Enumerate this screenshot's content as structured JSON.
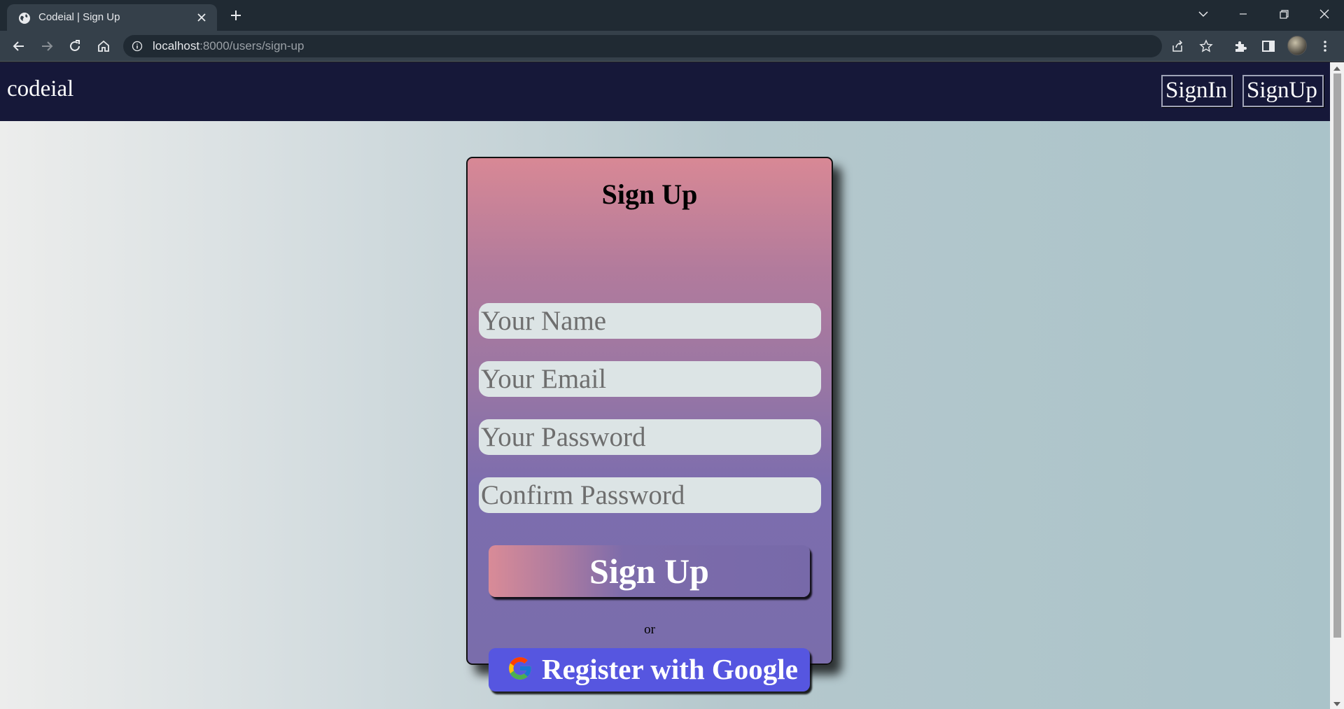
{
  "browser": {
    "tab_title": "Codeial | Sign Up",
    "url_host": "localhost",
    "url_rest": ":8000/users/sign-up"
  },
  "navbar": {
    "brand": "codeial",
    "signin_label": "SignIn",
    "signup_label": "SignUp"
  },
  "form": {
    "title": "Sign Up",
    "fields": [
      {
        "placeholder": "Your Name",
        "value": ""
      },
      {
        "placeholder": "Your Email",
        "value": ""
      },
      {
        "placeholder": "Your Password",
        "value": ""
      },
      {
        "placeholder": "Confirm Password",
        "value": ""
      }
    ],
    "submit_label": "Sign Up",
    "or_text": "or",
    "google_label": "Register with Google"
  },
  "colors": {
    "navbar_bg": "#161839",
    "google_button": "#5656e0",
    "card_top": "#d88895",
    "card_bottom": "#7a6dab"
  },
  "icons": [
    "globe-icon",
    "close-icon",
    "plus-icon",
    "back-icon",
    "forward-icon",
    "reload-icon",
    "home-icon",
    "info-icon",
    "share-icon",
    "star-icon",
    "extensions-icon",
    "side-panel-icon",
    "menu-icon",
    "google-icon"
  ]
}
